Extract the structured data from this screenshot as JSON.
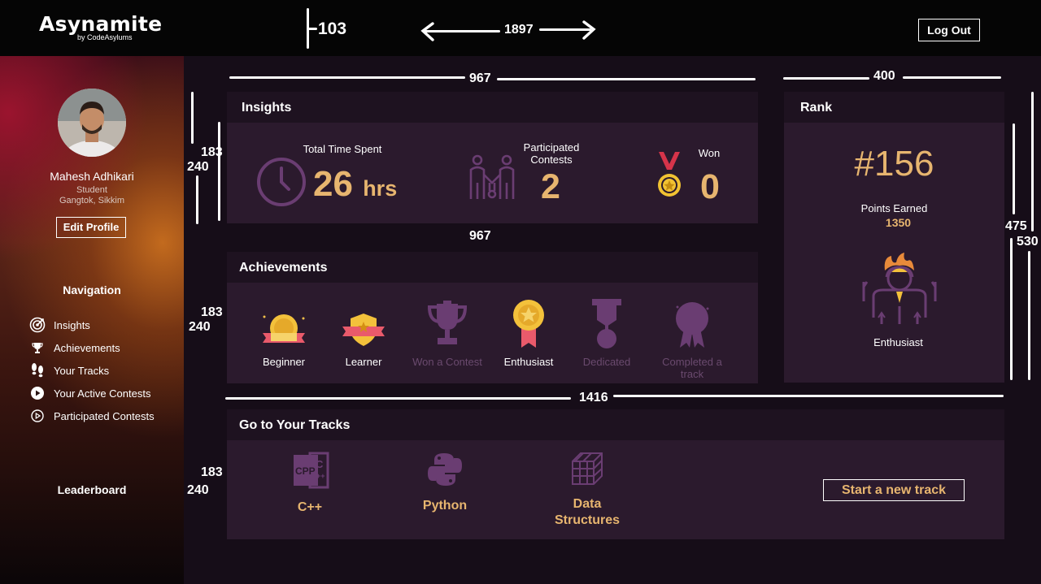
{
  "header": {
    "brand": "Asynamite",
    "brand_sub": "by CodeAsylums",
    "logout_label": "Log Out"
  },
  "profile": {
    "name": "Mahesh Adhikari",
    "role": "Student",
    "location": "Gangtok, Sikkim",
    "edit_label": "Edit Profile"
  },
  "navigation": {
    "title": "Navigation",
    "items": [
      {
        "label": "Insights",
        "icon": "target-icon"
      },
      {
        "label": "Achievements",
        "icon": "trophy-icon"
      },
      {
        "label": "Your Tracks",
        "icon": "footsteps-icon"
      },
      {
        "label": "Your Active Contests",
        "icon": "play-circle-icon"
      },
      {
        "label": "Participated Contests",
        "icon": "play-circle-outline-icon"
      }
    ],
    "leaderboard": "Leaderboard"
  },
  "insights": {
    "title": "Insights",
    "time_label": "Total Time Spent",
    "time_value": "26",
    "time_unit": "hrs",
    "participated_label": "Participated Contests",
    "participated_value": "2",
    "won_label": "Won",
    "won_value": "0"
  },
  "achievements": {
    "title": "Achievements",
    "items": [
      {
        "label": "Beginner",
        "unlocked": true
      },
      {
        "label": "Learner",
        "unlocked": true
      },
      {
        "label": "Won a Contest",
        "unlocked": false
      },
      {
        "label": "Enthusiast",
        "unlocked": true
      },
      {
        "label": "Dedicated",
        "unlocked": false
      },
      {
        "label": "Completed a track",
        "unlocked": false
      }
    ]
  },
  "rank": {
    "title": "Rank",
    "rank_value": "#156",
    "points_label": "Points Earned",
    "points_value": "1350",
    "badge_label": "Enthusiast"
  },
  "tracks": {
    "title": "Go to Your Tracks",
    "items": [
      {
        "label": "C++"
      },
      {
        "label": "Python"
      },
      {
        "label": "Data Structures"
      }
    ],
    "new_track_label": "Start a new track"
  },
  "annotations": {
    "top_103": "103",
    "top_1897": "1897",
    "w_967_a": "967",
    "w_400": "400",
    "w_967_b": "967",
    "w_1416": "1416",
    "h1_183": "183",
    "h1_240": "240",
    "h2_183": "183",
    "h2_240": "240",
    "h3_183": "183",
    "h3_240": "240",
    "r_475": "475",
    "r_530": "530"
  },
  "colors": {
    "accent_gold": "#e7b56f",
    "card_bg": "#2b1a2d",
    "card_head_bg": "#1e1220",
    "icon_purple": "#6a3d72",
    "page_bg": "#160d18"
  }
}
